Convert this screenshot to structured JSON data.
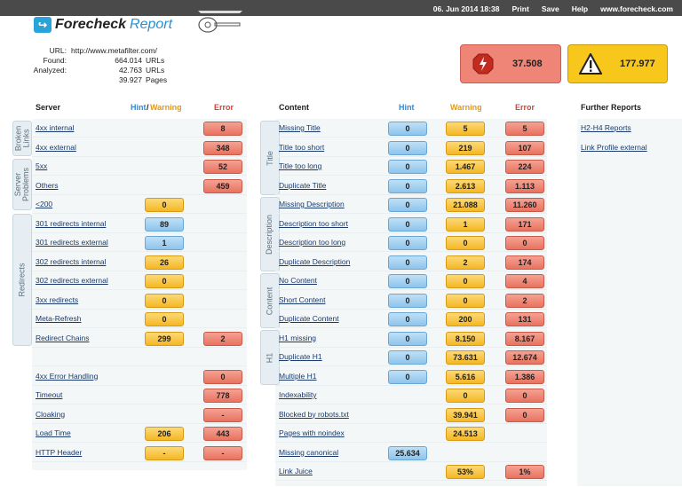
{
  "top_nav": {
    "date": "06. Jun 2014 18:38",
    "print": "Print",
    "save": "Save",
    "help": "Help",
    "site": "www.forecheck.com"
  },
  "logo": {
    "word1": "Forecheck",
    "word2": "Report"
  },
  "summary": {
    "url_label": "URL:",
    "url": "http://www.metafilter.com/",
    "found_label": "Found:",
    "found": "664.014",
    "found_unit": "URLs",
    "analyzed_label": "Analyzed:",
    "analyzed_urls": "42.763",
    "analyzed_urls_unit": "URLs",
    "analyzed_pages": "39.927",
    "analyzed_pages_unit": "Pages"
  },
  "totals": {
    "errors": "37.508",
    "warnings": "177.977"
  },
  "server": {
    "title": "Server",
    "hint_label": "Hint",
    "slash": "/",
    "warning_label": "Warning",
    "error_label": "Error",
    "rows": [
      {
        "label": "4xx internal",
        "hint": "",
        "warn": "",
        "err": "8"
      },
      {
        "label": "4xx external",
        "hint": "",
        "warn": "",
        "err": "348"
      },
      {
        "label": "5xx",
        "hint": "",
        "warn": "",
        "err": "52"
      },
      {
        "label": "Others",
        "hint": "",
        "warn": "",
        "err": "459"
      },
      {
        "label": "<200",
        "hint": "",
        "warn": "0",
        "err": ""
      },
      {
        "label": "301 redirects internal",
        "hint": "89",
        "warn": "",
        "err": ""
      },
      {
        "label": "301 redirects external",
        "hint": "1",
        "warn": "",
        "err": ""
      },
      {
        "label": "302 redirects internal",
        "hint": "",
        "warn": "26",
        "err": ""
      },
      {
        "label": "302 redirects external",
        "hint": "",
        "warn": "0",
        "err": ""
      },
      {
        "label": "3xx redirects",
        "hint": "",
        "warn": "0",
        "err": ""
      },
      {
        "label": "Meta-Refresh",
        "hint": "",
        "warn": "0",
        "err": ""
      },
      {
        "label": "Redirect Chains",
        "hint": "",
        "warn": "299",
        "err": "2"
      },
      {
        "label": "",
        "hint": "",
        "warn": "",
        "err": ""
      },
      {
        "label": "4xx Error Handling",
        "hint": "",
        "warn": "",
        "err": "0"
      },
      {
        "label": "Timeout",
        "hint": "",
        "warn": "",
        "err": "778"
      },
      {
        "label": "Cloaking",
        "hint": "",
        "warn": "",
        "err": "-"
      },
      {
        "label": "Load Time",
        "hint": "",
        "warn": "206",
        "err": "443"
      },
      {
        "label": "HTTP Header",
        "hint": "",
        "warn": "-",
        "err": "-"
      }
    ],
    "tabs": [
      "Broken Links",
      "Server Problems",
      "Redirects"
    ]
  },
  "content": {
    "title": "Content",
    "hint_label": "Hint",
    "warning_label": "Warning",
    "error_label": "Error",
    "rows": [
      {
        "label": "Missing Title",
        "hint": "0",
        "warn": "5",
        "err": "5"
      },
      {
        "label": "Title too short",
        "hint": "0",
        "warn": "219",
        "err": "107"
      },
      {
        "label": "Title too long",
        "hint": "0",
        "warn": "1.467",
        "err": "224"
      },
      {
        "label": "Duplicate Title",
        "hint": "0",
        "warn": "2.613",
        "err": "1.113"
      },
      {
        "label": "Missing Description",
        "hint": "0",
        "warn": "21.088",
        "err": "11.260"
      },
      {
        "label": "Description too short",
        "hint": "0",
        "warn": "1",
        "err": "171"
      },
      {
        "label": "Description too long",
        "hint": "0",
        "warn": "0",
        "err": "0"
      },
      {
        "label": "Duplicate Description",
        "hint": "0",
        "warn": "2",
        "err": "174"
      },
      {
        "label": "No Content",
        "hint": "0",
        "warn": "0",
        "err": "4"
      },
      {
        "label": "Short Content",
        "hint": "0",
        "warn": "0",
        "err": "2"
      },
      {
        "label": "Duplicate Content",
        "hint": "0",
        "warn": "200",
        "err": "131"
      },
      {
        "label": "H1 missing",
        "hint": "0",
        "warn": "8.150",
        "err": "8.167"
      },
      {
        "label": "Duplicate H1",
        "hint": "0",
        "warn": "73.631",
        "err": "12.674"
      },
      {
        "label": "Multiple H1",
        "hint": "0",
        "warn": "5.616",
        "err": "1.386"
      },
      {
        "label": "Indexability",
        "hint": "",
        "warn": "0",
        "err": "0"
      },
      {
        "label": "Blocked by robots.txt",
        "hint": "",
        "warn": "39.941",
        "err": "0"
      },
      {
        "label": "Pages with noindex",
        "hint": "",
        "warn": "24.513",
        "err": ""
      },
      {
        "label": "Missing canonical",
        "hint": "25.634",
        "warn": "",
        "err": ""
      },
      {
        "label": "Link Juice",
        "hint": "",
        "warn": "53%",
        "err": "1%"
      }
    ],
    "tabs": [
      "Title",
      "Description",
      "Content",
      "H1"
    ]
  },
  "further": {
    "title": "Further Reports",
    "links": [
      "H2-H4 Reports",
      "Link Profile external"
    ]
  }
}
